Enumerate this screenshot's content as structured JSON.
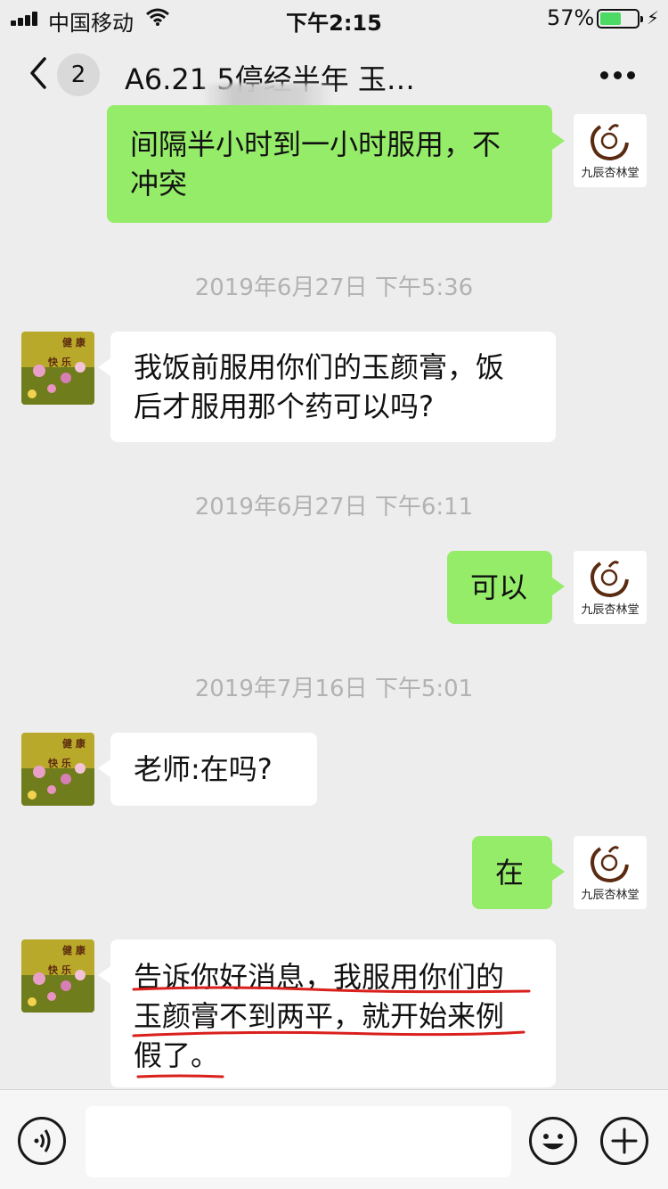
{
  "status_bar": {
    "carrier": "中国移动",
    "time": "下午2:15",
    "battery_percent_text": "57%",
    "battery_level": 0.57
  },
  "nav": {
    "back_badge": "2",
    "title": "A6.21        5停经半年 玉…"
  },
  "messages": [
    {
      "type": "text",
      "side": "out",
      "lines": [
        "间隔半小时到一小时服用，不",
        "冲突"
      ]
    },
    {
      "type": "time",
      "text": "2019年6月27日 下午5:36"
    },
    {
      "type": "text",
      "side": "in",
      "lines": [
        "我饭前服用你们的玉颜膏，饭",
        "后才服用那个药可以吗?"
      ]
    },
    {
      "type": "time",
      "text": "2019年6月27日 下午6:11"
    },
    {
      "type": "text",
      "side": "out",
      "lines": [
        "可以"
      ]
    },
    {
      "type": "time",
      "text": "2019年7月16日 下午5:01"
    },
    {
      "type": "text",
      "side": "in",
      "lines": [
        "老师:在吗?"
      ]
    },
    {
      "type": "text",
      "side": "out",
      "lines": [
        "在"
      ]
    },
    {
      "type": "text",
      "side": "in",
      "lines": [
        "告诉你好消息，我服用你们的",
        "玉颜膏不到两平，就开始来例",
        "假了。"
      ]
    }
  ],
  "avatars": {
    "self_label": "九辰杏林堂",
    "other_label_1": "健 康",
    "other_label_2": "快 乐"
  },
  "colors": {
    "outgoing_bubble": "#95ec69",
    "incoming_bubble": "#ffffff",
    "background": "#ededed",
    "annotation_red": "#d9201c"
  },
  "icons": {
    "back": "chevron-left-icon",
    "more": "more-dots-icon",
    "voice": "voice-icon",
    "emoji": "emoji-icon",
    "plus": "plus-icon"
  }
}
